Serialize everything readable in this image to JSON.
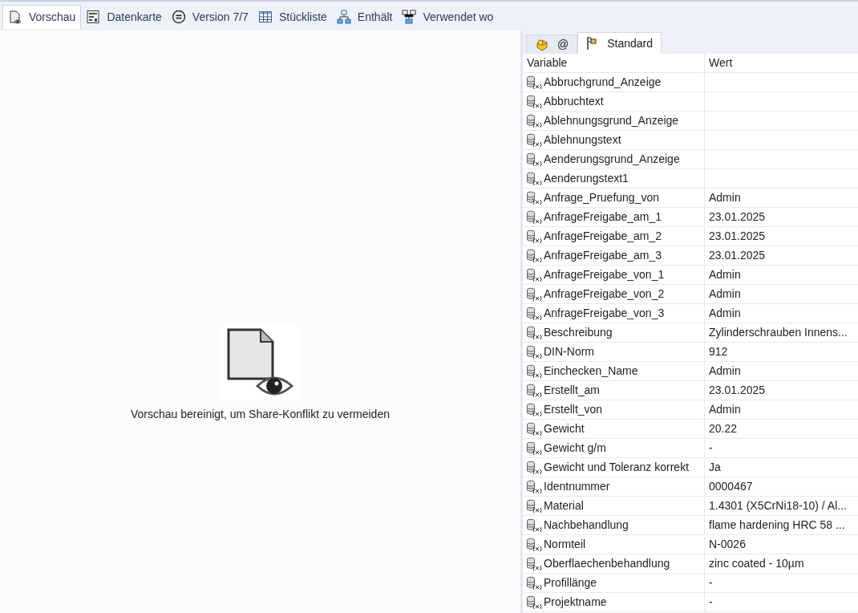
{
  "tabs": [
    {
      "label": "Vorschau",
      "selected": true
    },
    {
      "label": "Datenkarte",
      "selected": false
    },
    {
      "label": "Version 7/7",
      "selected": false
    },
    {
      "label": "Stückliste",
      "selected": false
    },
    {
      "label": "Enthält",
      "selected": false
    },
    {
      "label": "Verwendet wo",
      "selected": false
    }
  ],
  "preview": {
    "message": "Vorschau bereinigt, um Share-Konflikt zu vermeiden"
  },
  "panel_tabs": [
    {
      "label": "@",
      "selected": false
    },
    {
      "label": "Standard",
      "selected": true
    }
  ],
  "table": {
    "columns": [
      "Variable",
      "Wert"
    ],
    "rows": [
      {
        "variable": "Abbruchgrund_Anzeige"
      },
      {
        "variable": "Abbruchtext"
      },
      {
        "variable": "Ablehnungsgrund_Anzeige"
      },
      {
        "variable": "Ablehnungstext"
      },
      {
        "variable": "Aenderungsgrund_Anzeige"
      },
      {
        "variable": "Aenderungstext1"
      },
      {
        "variable": "Anfrage_Pruefung_von",
        "value": "Admin"
      },
      {
        "variable": "AnfrageFreigabe_am_1",
        "value": "23.01.2025"
      },
      {
        "variable": "AnfrageFreigabe_am_2",
        "value": "23.01.2025"
      },
      {
        "variable": "AnfrageFreigabe_am_3",
        "value": "23.01.2025"
      },
      {
        "variable": "AnfrageFreigabe_von_1",
        "value": "Admin"
      },
      {
        "variable": "AnfrageFreigabe_von_2",
        "value": "Admin"
      },
      {
        "variable": "AnfrageFreigabe_von_3",
        "value": "Admin"
      },
      {
        "variable": "Beschreibung",
        "value": "Zylinderschrauben Innens..."
      },
      {
        "variable": "DIN-Norm",
        "value": "912"
      },
      {
        "variable": "Einchecken_Name",
        "value": "Admin"
      },
      {
        "variable": "Erstellt_am",
        "value": "23.01.2025"
      },
      {
        "variable": "Erstellt_von",
        "value": "Admin"
      },
      {
        "variable": "Gewicht",
        "value": "20.22"
      },
      {
        "variable": "Gewicht g/m",
        "value": "-"
      },
      {
        "variable": "Gewicht und Toleranz korrekt",
        "value": "Ja"
      },
      {
        "variable": "Identnummer",
        "value": "0000467"
      },
      {
        "variable": "Material",
        "value": "1.4301 (X5CrNi18-10) / Al..."
      },
      {
        "variable": "Nachbehandlung",
        "value": "flame hardening HRC 58 ..."
      },
      {
        "variable": "Normteil",
        "value": "N-0026"
      },
      {
        "variable": "Oberflaechenbehandlung",
        "value": "zinc coated - 10µm"
      },
      {
        "variable": "Profillänge",
        "value": "-"
      },
      {
        "variable": "Projektname",
        "value": "-"
      }
    ]
  }
}
